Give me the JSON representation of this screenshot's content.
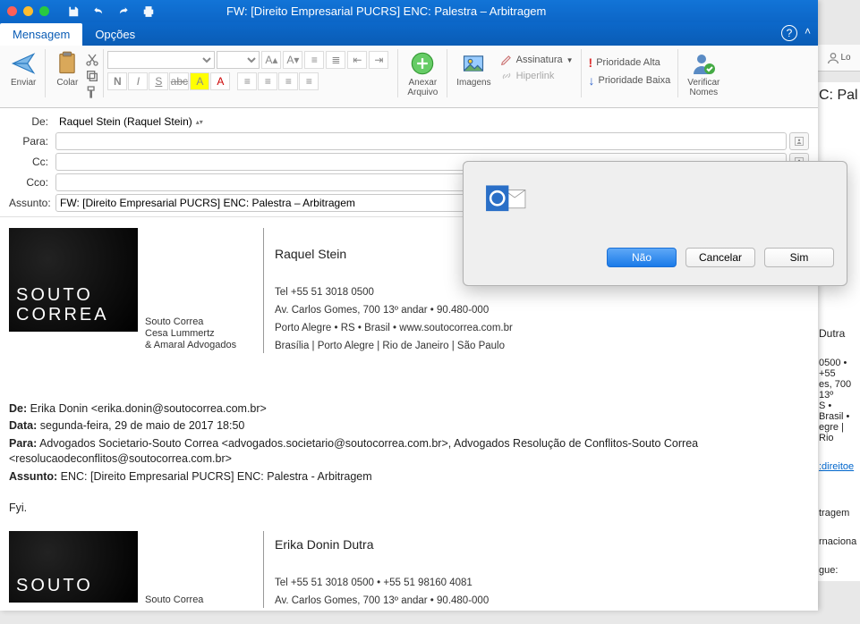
{
  "window": {
    "title": "FW: [Direito Empresarial PUCRS] ENC: Palestra – Arbitragem"
  },
  "tabs": {
    "message": "Mensagem",
    "options": "Opções"
  },
  "ribbon": {
    "send": "Enviar",
    "paste": "Colar",
    "attach": "Anexar\nArquivo",
    "images": "Imagens",
    "signature": "Assinatura",
    "hyperlink": "Hiperlink",
    "priority_high": "Prioridade Alta",
    "priority_low": "Prioridade Baixa",
    "verify_names": "Verificar\nNomes"
  },
  "envelope": {
    "from_label": "De:",
    "from_value": "Raquel Stein (Raquel Stein)",
    "to_label": "Para:",
    "to_value": "",
    "cc_label": "Cc:",
    "cc_value": "",
    "bcc_label": "Cco:",
    "bcc_value": "",
    "subject_label": "Assunto:",
    "subject_value": "FW: [Direito Empresarial PUCRS] ENC: Palestra – Arbitragem"
  },
  "signature1": {
    "logo_text": "SOUTO\nCORREA",
    "tagline": "Souto Correa\nCesa Lummertz\n& Amaral Advogados",
    "name": "Raquel Stein",
    "tel": "Tel +55 51 3018 0500",
    "addr": "Av. Carlos Gomes, 700 13º andar • 90.480-000",
    "city": "Porto Alegre • RS • Brasil • www.soutocorrea.com.br",
    "offices": "Brasília | Porto Alegre | Rio de Janeiro | São Paulo"
  },
  "forward_headers": {
    "from_lbl": "De:",
    "from_val": " Erika Donin <erika.donin@soutocorrea.com.br>",
    "date_lbl": "Data:",
    "date_val": " segunda-feira, 29 de maio de 2017 18:50",
    "to_lbl": "Para:",
    "to_val": " Advogados Societario-Souto Correa <advogados.societario@soutocorrea.com.br>, Advogados Resolução de Conflitos-Souto Correa <resolucaodeconflitos@soutocorrea.com.br>",
    "subj_lbl": "Assunto:",
    "subj_val": " ENC: [Direito Empresarial PUCRS] ENC: Palestra - Arbitragem"
  },
  "body_text": "Fyi.",
  "signature2": {
    "logo_text": "SOUTO",
    "tagline": "Souto Correa",
    "name": "Erika Donin Dutra",
    "tel": "Tel +55 51 3018 0500 • +55 51 98160 4081",
    "addr": "Av. Carlos Gomes, 700 13º andar • 90.480-000"
  },
  "dialog": {
    "no": "Não",
    "cancel": "Cancelar",
    "yes": "Sim"
  },
  "behind": {
    "login": "Lo",
    "subject": "C: Pal",
    "name": "Dutra",
    "tel": "0500 • +55",
    "addr": "es, 700 13º",
    "city": "S • Brasil •",
    "off": "egre | Rio",
    "link": ":direitoe",
    "s2": "tragem",
    "s3": "rnaciona",
    "s4": "gue:"
  }
}
